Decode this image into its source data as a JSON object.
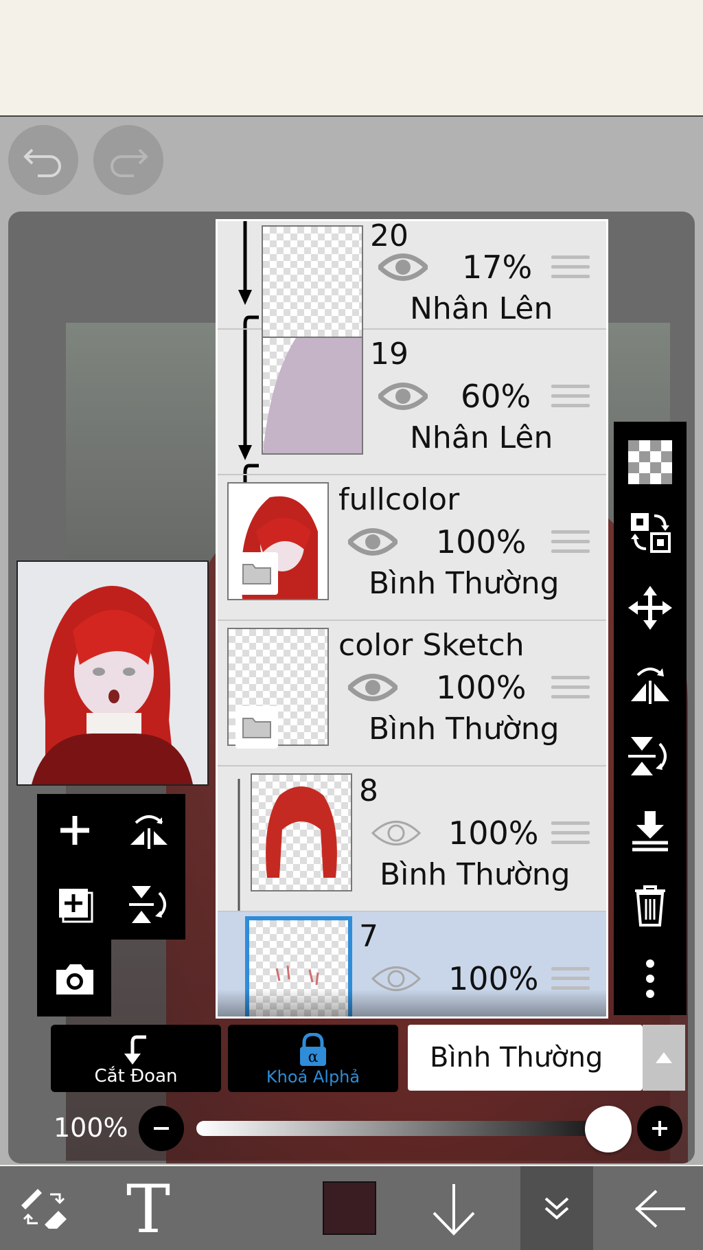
{
  "layers": [
    {
      "name": "20",
      "opacity": "17%",
      "blend": "Nhân Lên",
      "visible": true
    },
    {
      "name": "19",
      "opacity": "60%",
      "blend": "Nhân Lên",
      "visible": true
    },
    {
      "name": "fullcolor",
      "opacity": "100%",
      "blend": "Bình Thường",
      "visible": true
    },
    {
      "name": "color Sketch",
      "opacity": "100%",
      "blend": "Bình Thường",
      "visible": true
    },
    {
      "name": "8",
      "opacity": "100%",
      "blend": "Bình Thường",
      "visible": false
    },
    {
      "name": "7",
      "opacity": "100%",
      "blend": "Bình Thường",
      "visible": false,
      "selected": true
    }
  ],
  "actions": {
    "clipping_label": "Cắt Đoan",
    "alpha_lock_label": "Khoá Alphả"
  },
  "blend_mode": {
    "value": "Bình Thường"
  },
  "layer_opacity": {
    "label": "100%",
    "value": 1.0
  },
  "colors": {
    "current_color": "#3a1d22",
    "accent": "#2f8cd8",
    "selected_row": "#c9d6ea"
  },
  "icons": {
    "undo": "undo-icon",
    "redo": "redo-icon",
    "add_layer": "plus-icon",
    "flip_h": "flip-horizontal-icon",
    "add_copy": "add-copy-icon",
    "flip_v": "flip-vertical-icon",
    "camera": "camera-icon",
    "checker": "checker-icon",
    "transform": "transform-icon",
    "move": "move-icon",
    "merge_down": "merge-down-icon",
    "trash": "trash-icon",
    "more": "more-icon",
    "lock": "lock-icon",
    "brush_eraser": "brush-eraser-icon",
    "text": "text-icon",
    "down": "arrow-down-icon",
    "double_down": "double-chevron-down-icon",
    "back": "arrow-left-icon"
  }
}
